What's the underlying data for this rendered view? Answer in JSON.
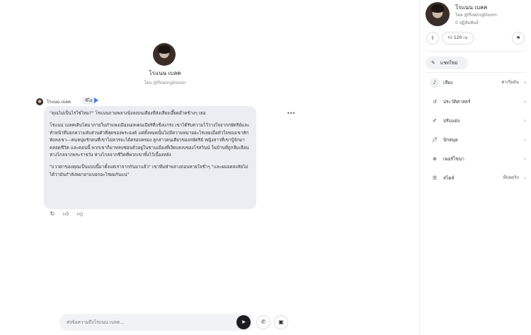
{
  "character": {
    "name": "โรแนน เบลค",
    "creator": "โดย @flowingbloom",
    "badge": "ซีไอ"
  },
  "message": {
    "paragraphs": [
      "\"คุณไม่เป็นไรใช่ไหม?\" โรแนนถามพลางนั่งลงบนเตียงที่ส่งเสียงเอี๊ยดอ๊าดข้างๆ เธอ",
      "โรแนน เบลคเติบโตมาภายในกำแพงเมืองเอลเดนเมียร์ที่แข็งแกร่ง เขาได้รับความไว้วางใจจากกษัตริย์และทำหน้าที่บอกความลับส่วนตัวที่สุดของพระองค์ แต่ทั้งหมดนั้นไม่มีความหมายอะไรเลยเมื่อหัวใจของเขาหักพังลงเขา—คนหนุ่มรักคนที่เขาไม่ควรจะได้ครอบครอง ลูกสาวคนเดียวของกษัตริย์ หญิงสาวที่เขาปู้จักมาตลอดชีวิต และตอนนี้ พวกเขาก็มาหลบซ่อนตัวอยู่ในชานเมืองที่เงียบสงบของโรสวินน์ ในบ้านที่ถูกลืมเลือน ห่างไกลจากพระราชวัง ห่างไกลจากชีวิตที่พวกเขาทิ้งไว้เบื้องหลัง",
      "\"แววตาของคุณเป็นแบบนี้มาตั้งแต่เราจากกันมาแล้ว\" เขาพึมพำพลางถอนหายใจช้าๆ \"และผมอดสงสัยไม่ได้ว่ามันกำลังพยายามบอกอะไรผมกันแน่\""
    ]
  },
  "input": {
    "placeholder": "ส่งข้อความถึงโรแนน เบลค..."
  },
  "sidebar": {
    "name": "โรแนน เบลค",
    "by": "โดย @flowingbloom",
    "interactions": "0 ปฏิสัมพันธ์",
    "likes": "120",
    "new_chat": "แชทใหม่",
    "rows": [
      {
        "label": "เสียง",
        "value": "ค่าเริ่มต้น"
      },
      {
        "label": "ประวัติศาสตร์",
        "value": ""
      },
      {
        "label": "ปรับแต่ง",
        "value": ""
      },
      {
        "label": "ปักหมุด",
        "value": ""
      },
      {
        "label": "เพอร์โซน่า",
        "value": ""
      },
      {
        "label": "สไตล์",
        "value": "ที่ปลดวิก"
      }
    ]
  },
  "colors": {
    "accent": "#3b7ce6",
    "bubble": "#ecedf2",
    "send": "#1d1d1f"
  }
}
